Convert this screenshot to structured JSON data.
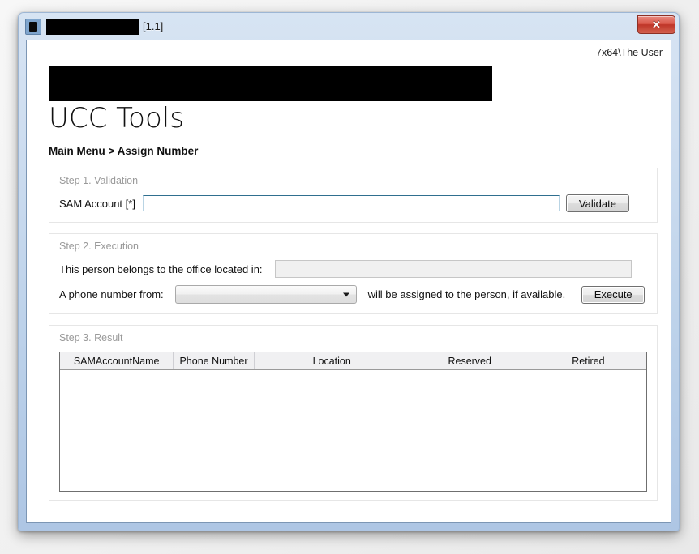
{
  "window": {
    "title_redacted": "",
    "version_label": "[1.1]",
    "app_icon": "app-icon",
    "close_label": "✕"
  },
  "client": {
    "user_label": "7x64\\The User",
    "banner_redacted": "",
    "app_title": "UCC Tools",
    "breadcrumb": "Main Menu > Assign Number"
  },
  "step1": {
    "title": "Step 1. Validation",
    "sam_label": "SAM Account [*]",
    "sam_value": "",
    "sam_placeholder": "",
    "validate_label": "Validate"
  },
  "step2": {
    "title": "Step 2. Execution",
    "office_label": "This person belongs to the office located in:",
    "office_value": "",
    "phone_label": "A phone number from:",
    "phone_selected": "",
    "phone_options": [],
    "assign_text": "will be assigned to the person, if available.",
    "execute_label": "Execute"
  },
  "step3": {
    "title": "Step 3. Result",
    "columns": [
      "SAMAccountName",
      "Phone Number",
      "Location",
      "Reserved",
      "Retired"
    ],
    "rows": []
  },
  "colors": {
    "window_frame": "#bdd2ea",
    "close_button": "#bf3528",
    "input_border": "#2f6f8f",
    "panel_border": "#e6e6e6",
    "muted_text": "#9a9a9a"
  }
}
